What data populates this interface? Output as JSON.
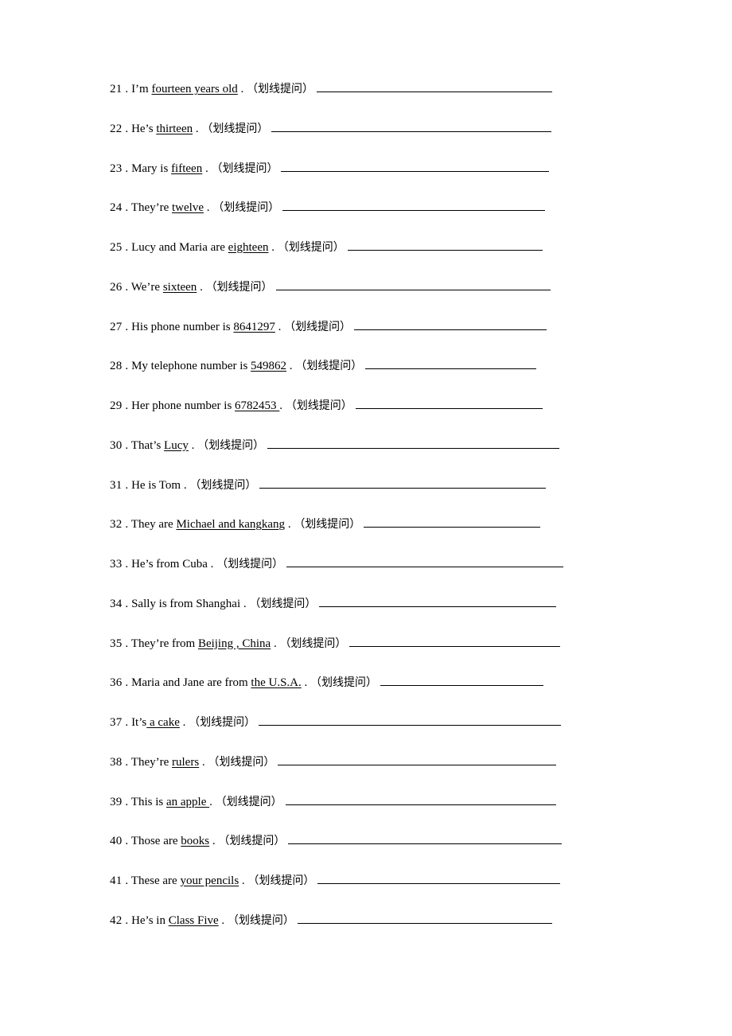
{
  "document": {
    "type": "english-grammar-worksheet",
    "instruction_note": "（划线提问）",
    "items": [
      {
        "number": "21 .",
        "pre": "I’m ",
        "underlined": "fourteen years old",
        "post": " .",
        "prompt": "（划线提问）",
        "blank_width": 296
      },
      {
        "number": "22 .",
        "pre": "He’s ",
        "underlined": "thirteen",
        "post": " .",
        "prompt": "（划线提问）",
        "blank_width": 352
      },
      {
        "number": "23 .",
        "pre": "Mary is ",
        "underlined": "fifteen",
        "post": " .",
        "prompt": "（划线提问）",
        "blank_width": 337
      },
      {
        "number": "24 .",
        "pre": "They’re ",
        "underlined": "twelve",
        "post": " .",
        "prompt": "（划线提问）",
        "blank_width": 330
      },
      {
        "number": "25 .",
        "pre": "Lucy and Maria are ",
        "underlined": "eighteen",
        "post": " .",
        "prompt": "（划线提问）",
        "blank_width": 245
      },
      {
        "number": "26 .",
        "pre": "We’re ",
        "underlined": "sixteen",
        "post": " .",
        "prompt": "（划线提问）",
        "blank_width": 345
      },
      {
        "number": "27 .",
        "pre": "His phone number is ",
        "underlined": "8641297",
        "post": " .",
        "prompt": "（划线提问）",
        "blank_width": 242
      },
      {
        "number": "28 .",
        "pre": "My telephone number is ",
        "underlined": "549862",
        "post": " .",
        "prompt": "（划线提问）",
        "blank_width": 215
      },
      {
        "number": "29 .",
        "pre": "Her phone number is ",
        "underlined": "6782453 ",
        "post": " .",
        "prompt": "（划线提问）",
        "blank_width": 235
      },
      {
        "number": "30 .",
        "pre": "That’s ",
        "underlined": "Lucy",
        "post": " .",
        "prompt": "（划线提问）",
        "blank_width": 367
      },
      {
        "number": "31 .",
        "pre": "He is Tom .",
        "underlined": "",
        "post": "",
        "prompt": "（划线提问）",
        "blank_width": 360
      },
      {
        "number": "32 .",
        "pre": "They are ",
        "underlined": "Michael and kangkang",
        "post": " .",
        "prompt": "（划线提问）",
        "blank_width": 222
      },
      {
        "number": "33 .",
        "pre": "He’s from Cuba .",
        "underlined": "",
        "post": "",
        "prompt": "（划线提问）",
        "blank_width": 348
      },
      {
        "number": "34 .",
        "pre": "Sally is from Shanghai .",
        "underlined": "",
        "post": "",
        "prompt": "（划线提问）",
        "blank_width": 298
      },
      {
        "number": "35 .",
        "pre": "They’re from ",
        "underlined": "Beijing , China",
        "post": " .",
        "prompt": "（划线提问）",
        "blank_width": 265
      },
      {
        "number": "36 .",
        "pre": "Maria and Jane are from ",
        "underlined": "the U.S.A.",
        "post": " .",
        "prompt": "（划线提问）",
        "blank_width": 205
      },
      {
        "number": "37 .",
        "pre": "It’s",
        "underlined": " a cake",
        "post": " .",
        "prompt": "（划线提问）",
        "blank_width": 380
      },
      {
        "number": "38 .",
        "pre": "They’re ",
        "underlined": "rulers",
        "post": " .",
        "prompt": "（划线提问）",
        "blank_width": 350
      },
      {
        "number": "39 .",
        "pre": "This is ",
        "underlined": "an apple ",
        "post": " .",
        "prompt": "（划线提问）",
        "blank_width": 340
      },
      {
        "number": "40 .",
        "pre": "Those are ",
        "underlined": "books",
        "post": " .",
        "prompt": "（划线提问）",
        "blank_width": 344
      },
      {
        "number": "41 .",
        "pre": "These are ",
        "underlined": "your pencils",
        "post": " .",
        "prompt": "（划线提问）",
        "blank_width": 305
      },
      {
        "number": "42 .",
        "pre": "He’s in ",
        "underlined": "Class Five",
        "post": " .",
        "prompt": "（划线提问）",
        "blank_width": 320
      }
    ]
  }
}
